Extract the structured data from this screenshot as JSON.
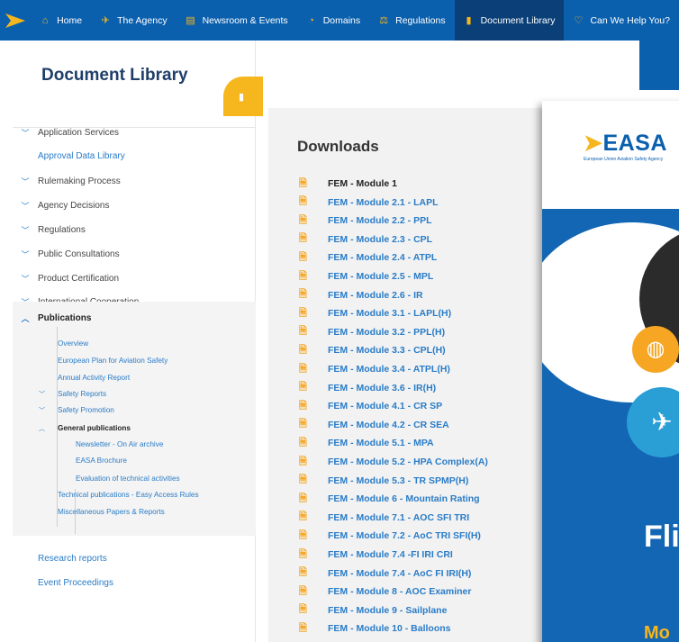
{
  "nav": {
    "items": [
      {
        "label": "Home",
        "icon": "home-icon",
        "glyph": "⌂"
      },
      {
        "label": "The Agency",
        "icon": "plane-icon",
        "glyph": "✈"
      },
      {
        "label": "Newsroom & Events",
        "icon": "calendar-icon",
        "glyph": "▤"
      },
      {
        "label": "Domains",
        "icon": "domains-icon",
        "glyph": "◔"
      },
      {
        "label": "Regulations",
        "icon": "scales-icon",
        "glyph": "⚖"
      },
      {
        "label": "Document Library",
        "icon": "document-icon",
        "glyph": "▮"
      },
      {
        "label": "Can We Help You?",
        "icon": "heart-icon",
        "glyph": "♡"
      }
    ],
    "active_index": 5
  },
  "sidebar": {
    "title": "Document Library",
    "items": [
      {
        "label": "Application Services",
        "chevron": true
      },
      {
        "label": "Approval Data Library",
        "chevron": false
      },
      {
        "label": "Rulemaking Process",
        "chevron": true
      },
      {
        "label": "Agency Decisions",
        "chevron": true
      },
      {
        "label": "Regulations",
        "chevron": true
      },
      {
        "label": "Public Consultations",
        "chevron": true
      },
      {
        "label": "Product Certification",
        "chevron": true
      },
      {
        "label": "International Cooperation",
        "chevron": true
      }
    ],
    "publications": {
      "label": "Publications",
      "children": [
        {
          "label": "Overview"
        },
        {
          "label": "European Plan for Aviation Safety"
        },
        {
          "label": "Annual Activity Report"
        },
        {
          "label": "Safety Reports"
        },
        {
          "label": "Safety Promotion"
        },
        {
          "label": "General publications"
        },
        {
          "label": "Newsletter - On Air archive"
        },
        {
          "label": "EASA Brochure"
        },
        {
          "label": "Evaluation of technical activities"
        },
        {
          "label": "Technical publications - Easy Access Rules"
        },
        {
          "label": "Miscellaneous Papers & Reports"
        }
      ]
    },
    "bottom": [
      {
        "label": "Research reports"
      },
      {
        "label": "Event Proceedings"
      }
    ]
  },
  "downloads": {
    "title": "Downloads",
    "files": [
      "FEM - Module 1",
      "FEM - Module 2.1 - LAPL",
      "FEM - Module 2.2 - PPL",
      "FEM - Module 2.3 - CPL",
      "FEM - Module 2.4 - ATPL",
      "FEM - Module 2.5 - MPL",
      "FEM - Module 2.6 - IR",
      "FEM - Module 3.1 - LAPL(H)",
      "FEM - Module 3.2 - PPL(H)",
      "FEM - Module 3.3 - CPL(H)",
      "FEM - Module 3.4 - ATPL(H)",
      "FEM - Module 3.6 - IR(H)",
      "FEM - Module 4.1 - CR SP",
      "FEM - Module 4.2 - CR SEA",
      "FEM - Module 5.1 - MPA",
      "FEM - Module 5.2 - HPA Complex(A)",
      "FEM - Module 5.3 - TR SPMP(H)",
      "FEM - Module 6 - Mountain Rating",
      "FEM - Module 7.1 - AOC SFI TRI",
      "FEM - Module 7.2 - AoC TRI SFI(H)",
      "FEM - Module 7.4 -FI IRI CRI",
      "FEM - Module 7.4 - AoC FI IRI(H)",
      "FEM - Module 8 - AOC Examiner",
      "FEM - Module 9 - Sailplane",
      "FEM - Module 10 - Balloons"
    ]
  },
  "cover": {
    "logo": "EASA",
    "tagline": "European Union Aviation Safety Agency",
    "heading": "Flig",
    "subheading": "Mo"
  },
  "colors": {
    "nav_bg": "#0b60ae",
    "nav_active": "#0a3f77",
    "accent": "#f6b61e",
    "link": "#2a7cc7",
    "title": "#1f3e6a"
  }
}
